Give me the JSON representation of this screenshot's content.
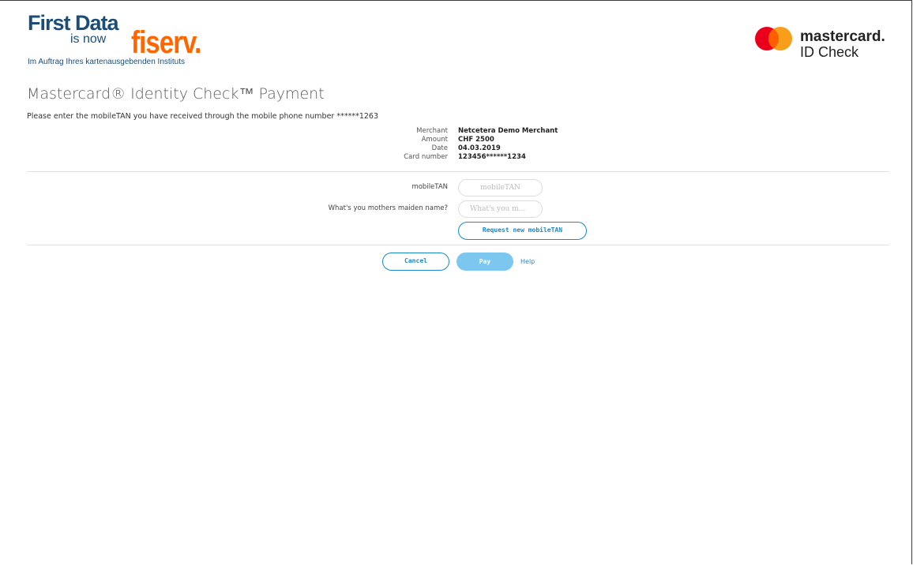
{
  "brand": {
    "first_data": "First Data",
    "is_now": "is now",
    "fiserv": "fiserv.",
    "subtitle": "Im Auftrag Ihres kartenausgebenden Instituts",
    "mastercard": "mastercard.",
    "id_check": "ID Check",
    "colors": {
      "first_data_blue": "#1c4d78",
      "fiserv_orange": "#ff6600",
      "mc_red": "#eb001b",
      "mc_orange": "#f79e1b",
      "accent_blue": "#1a88c9"
    }
  },
  "page": {
    "title": "Mastercard® Identity Check™ Payment",
    "instruction": "Please enter the mobileTAN you have received through the mobile phone number ******1263"
  },
  "details": [
    {
      "label": "Merchant",
      "value": "Netcetera Demo Merchant"
    },
    {
      "label": "Amount",
      "value": "CHF 2500"
    },
    {
      "label": "Date",
      "value": "04.03.2019"
    },
    {
      "label": "Card number",
      "value": "123456******1234"
    }
  ],
  "form": {
    "mobiletan_label": "mobileTAN",
    "mobiletan_placeholder": "mobileTAN",
    "maiden_label": "What's you mothers maiden name?",
    "maiden_placeholder": "What's you m...",
    "request_button": "Request new mobileTAN"
  },
  "actions": {
    "cancel": "Cancel",
    "pay": "Pay",
    "help": "Help"
  }
}
